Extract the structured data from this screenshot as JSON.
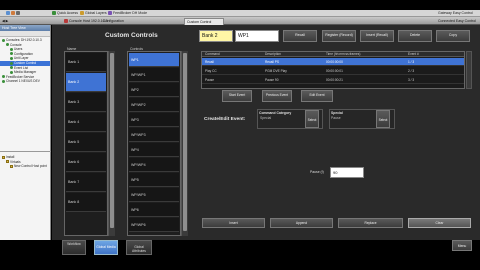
{
  "os_toolbar": {
    "items": [
      "Quick Access",
      "Global Layers",
      "FeedBroker DH Mode"
    ],
    "right_text": "Gateway Easy Control"
  },
  "doc_tabs": {
    "tabs": [
      "Console Host 192.0.10.3",
      "Configuration",
      "Custom Control"
    ],
    "active": "Custom Control",
    "right_text": "Connected Easy Control"
  },
  "explorer": {
    "title": "Host Tree View",
    "items": [
      {
        "label": "Consoles: DH.192.0.10.3",
        "indent": 0,
        "dot": "#3a8f3a"
      },
      {
        "label": "Console",
        "indent": 1,
        "dot": "#3a8f3a"
      },
      {
        "label": "Users",
        "indent": 2,
        "dot": "#3a8f3a"
      },
      {
        "label": "Configuration",
        "indent": 2,
        "dot": "#3a8f3a"
      },
      {
        "label": "Unit Layer",
        "indent": 2,
        "dot": "#3a8f3a"
      },
      {
        "label": "Custom Control",
        "indent": 2,
        "dot": "#3a8f3a",
        "selected": true
      },
      {
        "label": "Event List",
        "indent": 2,
        "dot": "#3a8f3a"
      },
      {
        "label": "Media Manager",
        "indent": 2,
        "dot": "#3a8f3a"
      },
      {
        "label": "FeedBroker Service",
        "indent": 0,
        "dot": "#3a8f3a"
      },
      {
        "label": "Channel 1 NEXUS DEV",
        "indent": 0,
        "dot": "#3a8f3a"
      }
    ],
    "lower_items": [
      {
        "label": "Install",
        "indent": 0
      },
      {
        "label": "Virtuals",
        "indent": 1
      },
      {
        "label": "New Control Host point",
        "indent": 2
      }
    ]
  },
  "custom_controls": {
    "title": "Custom Controls",
    "name_header": "Name",
    "controls_header": "Controls",
    "banks": [
      "Bank 1",
      "Bank 2",
      "Bank 3",
      "Bank 4",
      "Bank 5",
      "Bank 6",
      "Bank 7",
      "Bank 8"
    ],
    "selected_bank": 1,
    "controls": [
      "WP1",
      "WP/WP1",
      "WP2",
      "WP/WP2",
      "WP3",
      "WP/WP3",
      "WP4",
      "WP/WP4",
      "WP5",
      "WP/WP5",
      "WP6",
      "WP/WP6"
    ],
    "selected_control": 0
  },
  "header": {
    "bank_value": "Bank 2",
    "wp_value": "WP1",
    "buttons": [
      "Recall",
      "Register (Record)",
      "Insert (Recall)",
      "Delete",
      "Copy"
    ]
  },
  "events_table": {
    "headers": [
      "Command",
      "Description",
      "Time (hh:mm:ss:frames)",
      "Event #"
    ],
    "rows": [
      {
        "cells": [
          "Recall",
          "Recall PS",
          "00:00:00:00",
          "1 / 3"
        ],
        "selected": true
      },
      {
        "cells": [
          "Play CC",
          "PGM DVE Play",
          "00:00:00:01",
          "2 / 3"
        ],
        "selected": false
      },
      {
        "cells": [
          "Pause",
          "Pause 90",
          "00:00:00:21",
          "3 / 3"
        ],
        "selected": false
      }
    ],
    "row_buttons": [
      "Start Event",
      "Previous Event",
      "Edit Event"
    ]
  },
  "create_edit": {
    "title": "Create/Edit Event:",
    "command_category_label": "Command Category",
    "command_category_value": "Special",
    "special_label": "Special",
    "special_value": "Pause",
    "select_label": "Select",
    "pause_label": "Pause (f)",
    "pause_value": "90"
  },
  "action_buttons": [
    "Insert",
    "Append",
    "Replace",
    "Clear"
  ],
  "bottom_nav": {
    "buttons": [
      "Workflow",
      "Global Media",
      "Global Attributes"
    ],
    "active": 1,
    "menu_label": "Menu"
  },
  "colors": {
    "selection_blue": "#3f73d4",
    "bank_field_yellow": "#fff6a6",
    "panel_dark": "#2a2a2a"
  }
}
